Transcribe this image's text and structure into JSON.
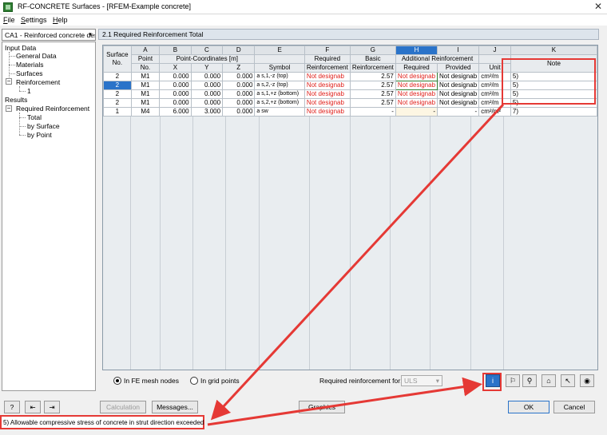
{
  "window": {
    "title": "RF-CONCRETE Surfaces - [RFEM-Example concrete]"
  },
  "menu": [
    {
      "label": "File",
      "u": "F",
      "rest": "ile"
    },
    {
      "label": "Settings",
      "u": "S",
      "rest": "ettings"
    },
    {
      "label": "Help",
      "u": "H",
      "rest": "elp"
    }
  ],
  "case_select": {
    "value": "CA1 - Reinforced concrete desi"
  },
  "nav": {
    "input_data": "Input Data",
    "general_data": "General Data",
    "materials": "Materials",
    "surfaces": "Surfaces",
    "reinforcement": "Reinforcement",
    "reinf_1": "1",
    "results": "Results",
    "required_reinforcement": "Required Reinforcement",
    "total": "Total",
    "by_surface": "by Surface",
    "by_point": "by Point"
  },
  "panel": {
    "title": "2.1 Required Reinforcement Total"
  },
  "table": {
    "letters": [
      "A",
      "B",
      "C",
      "D",
      "E",
      "F",
      "G",
      "H",
      "I",
      "J",
      "K"
    ],
    "h_surface": "Surface",
    "h_surface_no": "No.",
    "h_point": "Point",
    "h_point_no": "No.",
    "h_coords": "Point-Coordinates [m]",
    "h_x": "X",
    "h_y": "Y",
    "h_z": "Z",
    "h_symbol": "Symbol",
    "h_required": "Required",
    "h_required_2": "Reinforcement",
    "h_basic": "Basic",
    "h_basic_2": "Reinforcement",
    "h_additional": "Additional Reinforcement",
    "h_add_required": "Required",
    "h_add_provided": "Provided",
    "h_unit": "Unit",
    "h_note": "Note",
    "rows": [
      {
        "surface": "2",
        "point": "M1",
        "x": "0.000",
        "y": "0.000",
        "z": "0.000",
        "symbol": "a s,1,-z (top)",
        "required": "Not designab",
        "basic": "2.57",
        "add_required": "Not designab",
        "add_provided": "Not designab",
        "unit": "cm²/m",
        "note": "5)"
      },
      {
        "surface": "2",
        "point": "M1",
        "x": "0.000",
        "y": "0.000",
        "z": "0.000",
        "symbol": "a s,2,-z (top)",
        "required": "Not designab",
        "basic": "2.57",
        "add_required": "Not designab",
        "add_provided": "Not designab",
        "unit": "cm²/m",
        "note": "5)"
      },
      {
        "surface": "2",
        "point": "M1",
        "x": "0.000",
        "y": "0.000",
        "z": "0.000",
        "symbol": "a s,1,+z (bottom)",
        "required": "Not designab",
        "basic": "2.57",
        "add_required": "Not designab",
        "add_provided": "Not designab",
        "unit": "cm²/m",
        "note": "5)"
      },
      {
        "surface": "2",
        "point": "M1",
        "x": "0.000",
        "y": "0.000",
        "z": "0.000",
        "symbol": "a s,2,+z (bottom)",
        "required": "Not designab",
        "basic": "2.57",
        "add_required": "Not designab",
        "add_provided": "Not designab",
        "unit": "cm²/m",
        "note": "5)"
      },
      {
        "surface": "1",
        "point": "M4",
        "x": "6.000",
        "y": "3.000",
        "z": "0.000",
        "symbol": "a sw",
        "required": "Not designab",
        "basic": "-",
        "add_required": "-",
        "add_provided": "-",
        "unit": "cm²/m²",
        "note": "7)"
      }
    ]
  },
  "options": {
    "fe_mesh": "In FE mesh nodes",
    "grid_points": "In grid points",
    "required_for_label": "Required reinforcement for:",
    "required_for_value": "ULS"
  },
  "buttons": {
    "calculation": "Calculation",
    "messages": "Messages...",
    "graphics": "Graphics",
    "ok": "OK",
    "cancel": "Cancel"
  },
  "status": {
    "text": "5) Allowable compressive stress of concrete in strut direction exceeded"
  },
  "colors": {
    "accent": "#2a73c9",
    "annotation": "#e53935",
    "error_text": "#e0201b"
  }
}
